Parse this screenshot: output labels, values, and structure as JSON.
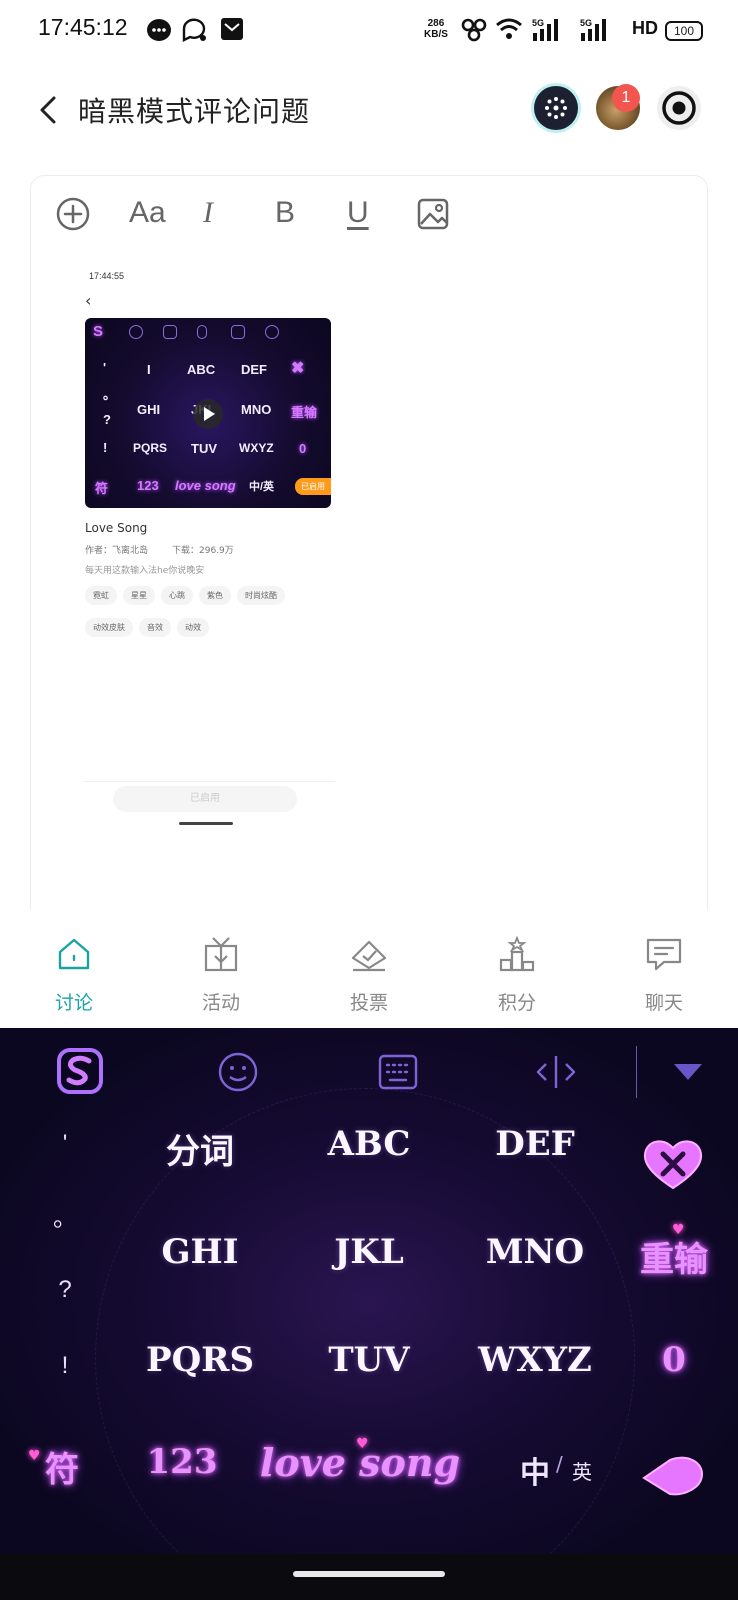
{
  "status_bar": {
    "time": "17:45:12",
    "net_speed_value": "286",
    "net_speed_unit": "KB/S",
    "hd_label": "HD",
    "battery": "100"
  },
  "header": {
    "title": "暗黑模式评论问题",
    "notification_count": "1"
  },
  "editor": {
    "toolbar": {
      "add_icon": "plus-circle-icon",
      "font_label": "Aa",
      "italic_label": "I",
      "bold_label": "B",
      "underline_label": "U",
      "image_icon": "image-icon"
    },
    "embedded_screenshot": {
      "status_time": "17:44:55",
      "keyboard_keys": {
        "row1": [
          "I",
          "ABC",
          "DEF"
        ],
        "row2": [
          "GHI",
          "JKL",
          "MNO",
          "重输"
        ],
        "row3": [
          "PQRS",
          "TUV",
          "WXYZ",
          "0"
        ],
        "row4": [
          "符",
          "123",
          "love song",
          "中/英"
        ],
        "symbols": [
          "'",
          "。",
          "?",
          "!"
        ]
      },
      "badge": "已启用",
      "skin_name": "Love Song",
      "author": "作者：飞离北岛",
      "downloads": "下载：296.9万",
      "description": "每天用这款输入法he你说晚安",
      "tags": [
        "霓虹",
        "星星",
        "心跳",
        "紫色",
        "时尚炫酷",
        "动效皮肤",
        "音效",
        "动效"
      ],
      "enabled_button": "已启用"
    }
  },
  "bottom_nav": {
    "items": [
      {
        "label": "讨论",
        "icon": "home-icon",
        "active": true
      },
      {
        "label": "活动",
        "icon": "gift-icon",
        "active": false
      },
      {
        "label": "投票",
        "icon": "vote-icon",
        "active": false
      },
      {
        "label": "积分",
        "icon": "podium-icon",
        "active": false
      },
      {
        "label": "聊天",
        "icon": "chat-icon",
        "active": false
      }
    ],
    "active_color": "#19a3a6"
  },
  "keyboard": {
    "symbols": [
      "'",
      "。",
      "?",
      "!"
    ],
    "rows": [
      [
        "分词",
        "ABC",
        "DEF"
      ],
      [
        "GHI",
        "JKL",
        "MNO"
      ],
      [
        "PQRS",
        "TUV",
        "WXYZ"
      ]
    ],
    "right_keys": {
      "retype": "重输",
      "zero": "0"
    },
    "bottom_row": {
      "symbol": "符",
      "numbers": "123",
      "space": "love song",
      "lang_cn": "中",
      "lang_en": "英"
    },
    "accent_color": "#e792ff"
  }
}
